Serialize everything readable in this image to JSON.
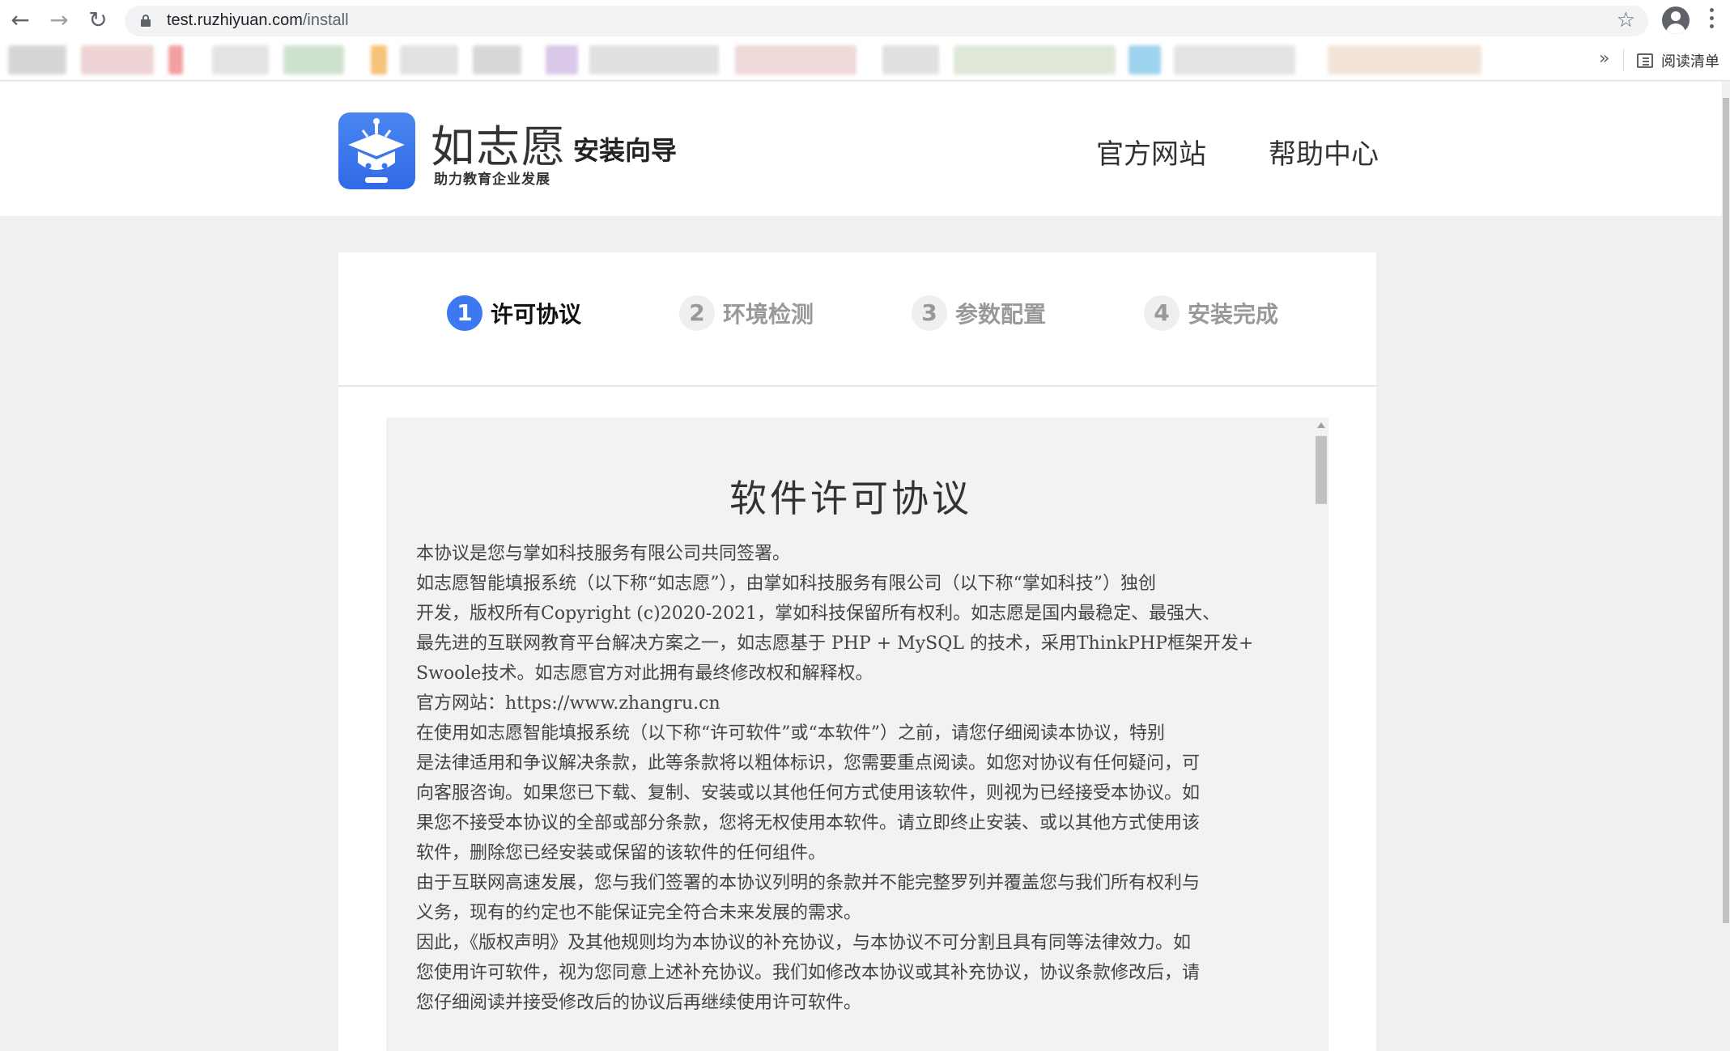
{
  "browser": {
    "url_host": "test.ruzhiyuan.com",
    "url_path": "/install",
    "reading_list_label": "阅读清单",
    "bookmarks_overflow": "»"
  },
  "header": {
    "brand_name": "如志愿",
    "brand_slogan": "助力教育企业发展",
    "brand_sub": "安装向导",
    "links": [
      "官方网站",
      "帮助中心"
    ]
  },
  "steps": [
    {
      "num": "1",
      "label": "许可协议",
      "active": true
    },
    {
      "num": "2",
      "label": "环境检测",
      "active": false
    },
    {
      "num": "3",
      "label": "参数配置",
      "active": false
    },
    {
      "num": "4",
      "label": "安装完成",
      "active": false
    }
  ],
  "agreement": {
    "title": "软件许可协议",
    "lines": [
      "本协议是您与掌如科技服务有限公司共同签署。",
      "如志愿智能填报系统（以下称“如志愿”），由掌如科技服务有限公司（以下称“掌如科技”）独创",
      "开发，版权所有Copyright (c)2020-2021，掌如科技保留所有权利。如志愿是国内最稳定、最强大、",
      "最先进的互联网教育平台解决方案之一，如志愿基于 PHP + MySQL 的技术，采用ThinkPHP框架开发+",
      "Swoole技术。如志愿官方对此拥有最终修改权和解释权。",
      "官方网站：https://www.zhangru.cn",
      "在使用如志愿智能填报系统（以下称“许可软件”或“本软件”）之前，请您仔细阅读本协议，特别",
      "是法律适用和争议解决条款，此等条款将以粗体标识，您需要重点阅读。如您对协议有任何疑问，可",
      "向客服咨询。如果您已下载、复制、安装或以其他任何方式使用该软件，则视为已经接受本协议。如",
      "果您不接受本协议的全部或部分条款，您将无权使用本软件。请立即终止安装、或以其他方式使用该",
      "软件，删除您已经安装或保留的该软件的任何组件。",
      "由于互联网高速发展，您与我们签署的本协议列明的条款并不能完整罗列并覆盖您与我们所有权利与",
      "义务，现有的约定也不能保证完全符合未来发展的需求。",
      "因此，《版权声明》及其他规则均为本协议的补充协议，与本协议不可分割且具有同等法律效力。如",
      "您使用许可软件，视为您同意上述补充协议。我们如修改本协议或其补充协议，协议条款修改后，请",
      "您仔细阅读并接受修改后的协议后再继续使用许可软件。"
    ]
  },
  "colors": {
    "accent": "#3c78f0",
    "logo_bg": "#3a77ee",
    "page_bg": "#f0f0f0"
  }
}
